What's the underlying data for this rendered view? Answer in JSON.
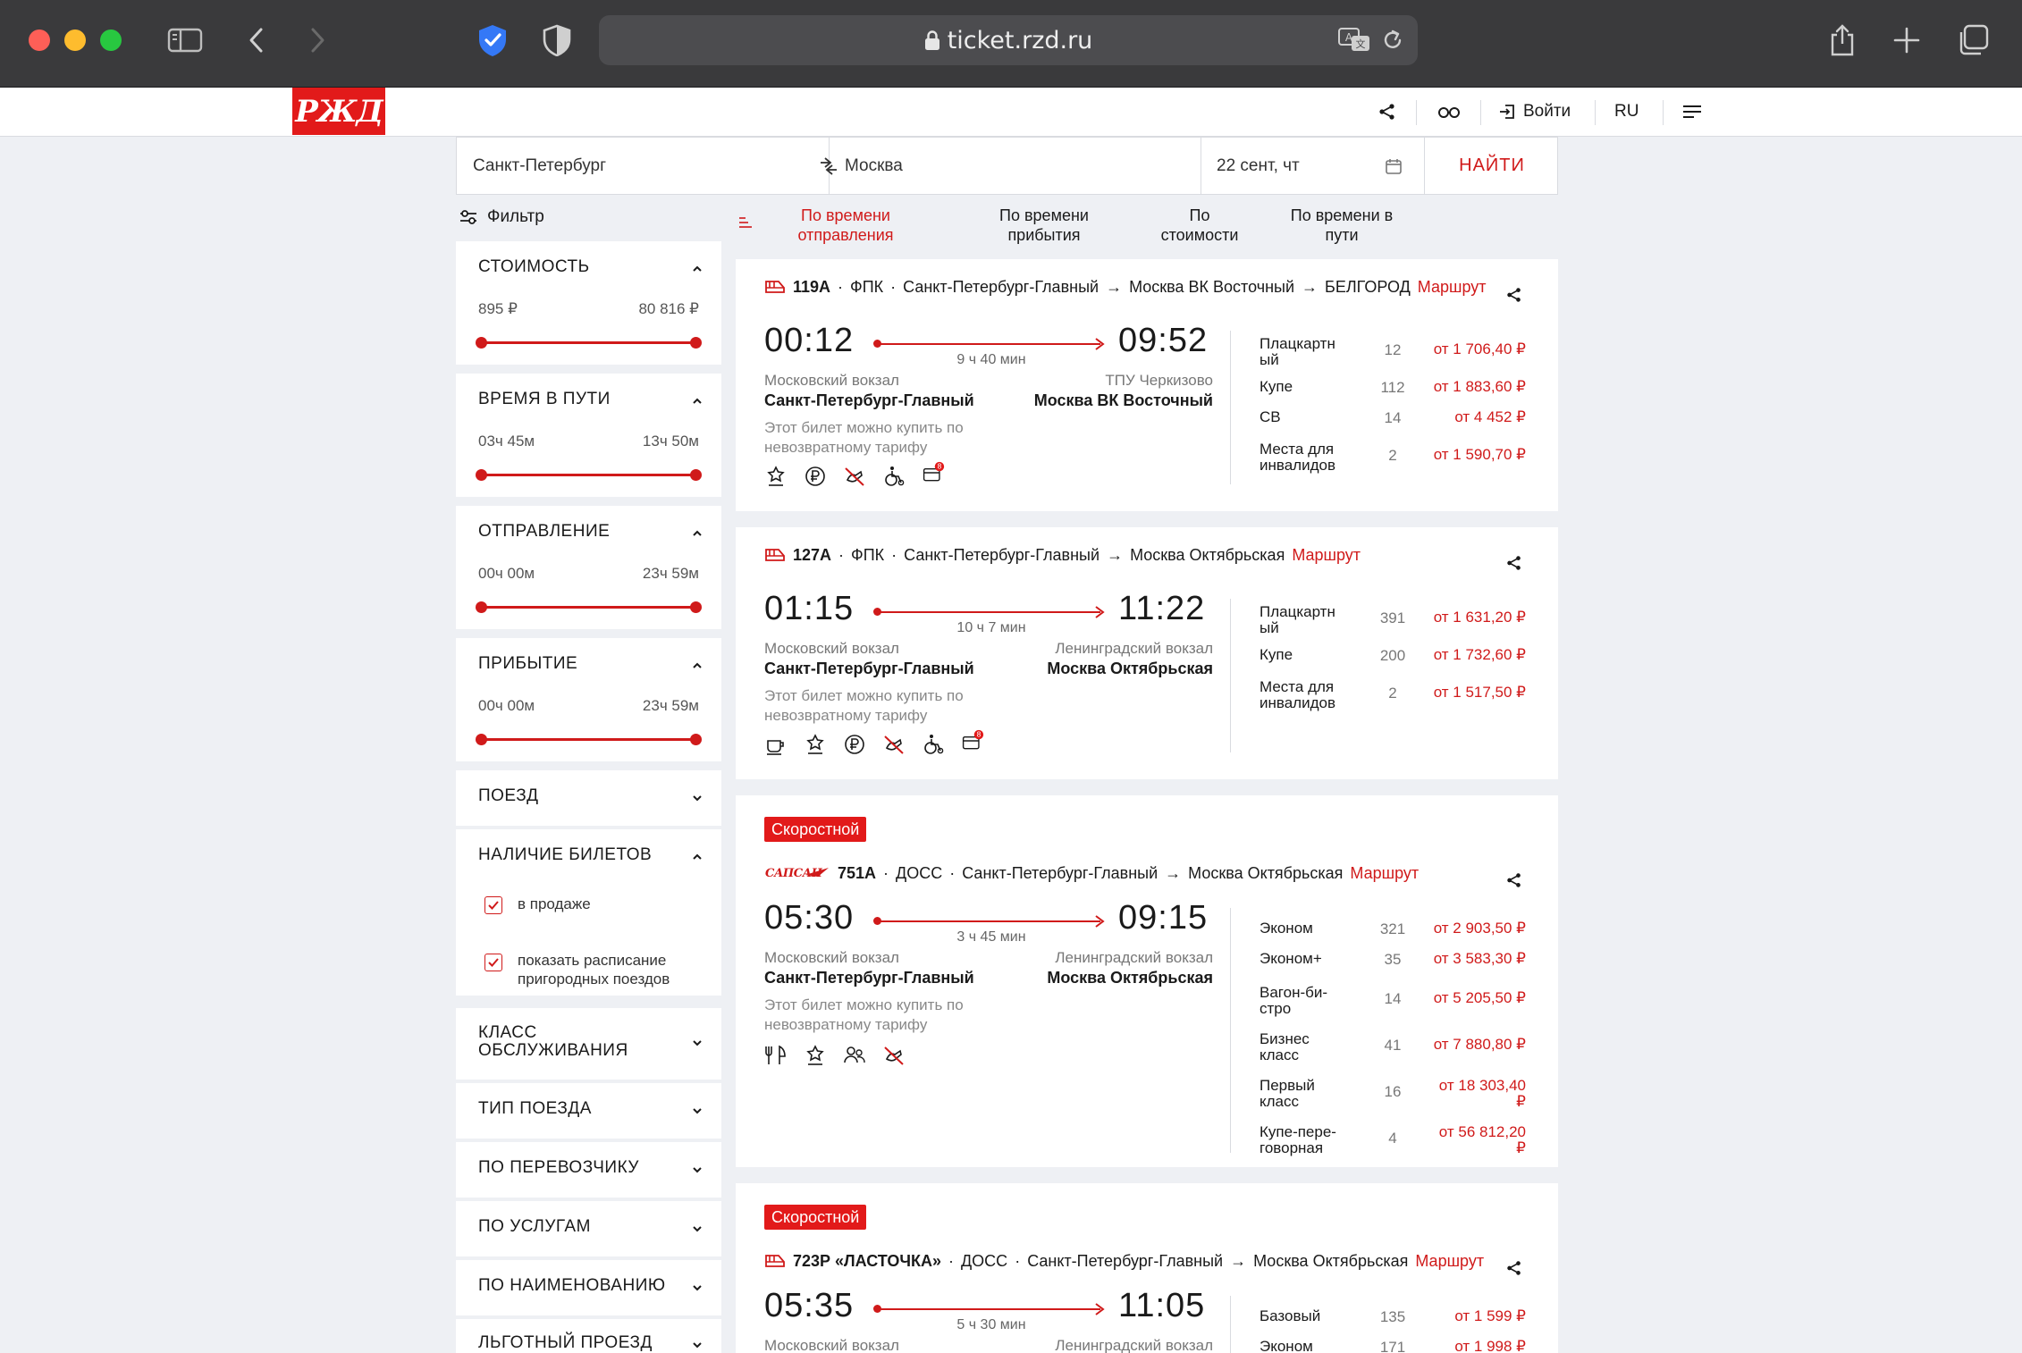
{
  "browser": {
    "url": "ticket.rzd.ru",
    "colors": {
      "chrome": "#3a3a3c",
      "close": "#fe5f57",
      "minimize": "#febc2e",
      "zoom": "#28c840"
    }
  },
  "site": {
    "logo_text": "РЖД",
    "header": {
      "login": "Войти",
      "lang": "RU"
    },
    "accent_color": "#e21a1a"
  },
  "search": {
    "from": "Санкт-Петербург",
    "to": "Москва",
    "date": "22 сент, чт",
    "find_button": "НАЙТИ"
  },
  "filter": {
    "title": "Фильтр",
    "cost": {
      "title": "СТОИМОСТЬ",
      "min": "895 ₽",
      "max": "80 816 ₽"
    },
    "duration": {
      "title": "ВРЕМЯ В ПУТИ",
      "min": "03ч 45м",
      "max": "13ч 50м"
    },
    "departure": {
      "title": "ОТПРАВЛЕНИЕ",
      "min": "00ч 00м",
      "max": "23ч 59м"
    },
    "arrival": {
      "title": "ПРИБЫТИЕ",
      "min": "00ч 00м",
      "max": "23ч 59м"
    },
    "train": {
      "title": "ПОЕЗД"
    },
    "tickets": {
      "title": "НАЛИЧИЕ БИЛЕТОВ",
      "on_sale": "в продаже",
      "suburban_l1": "показать расписание",
      "suburban_l2": "пригородных поездов"
    },
    "service_class": {
      "title_l1": "КЛАСС",
      "title_l2": "ОБСЛУЖИВАНИЯ"
    },
    "train_type": {
      "title": "ТИП ПОЕЗДА"
    },
    "carrier": {
      "title": "ПО ПЕРЕВОЗЧИКУ"
    },
    "services": {
      "title": "ПО УСЛУГАМ"
    },
    "name": {
      "title": "ПО НАИМЕНОВАНИЮ"
    },
    "benefit": {
      "title": "ЛЬГОТНЫЙ ПРОЕЗД"
    }
  },
  "sort": {
    "departure_l1": "По времени",
    "departure_l2": "отправления",
    "arrival_l1": "По времени",
    "arrival_l2": "прибытия",
    "cost_l1": "По",
    "cost_l2": "стоимости",
    "travel_l1": "По времени в",
    "travel_l2": "пути"
  },
  "trains": [
    {
      "number": "119А",
      "carrier": "ФПК",
      "route": "Санкт-Петербург-Главный",
      "to": "Москва ВК Восточный",
      "final": "БЕЛГОРОД",
      "route_link": "Маршрут",
      "dep_time": "00:12",
      "arr_time": "09:52",
      "duration": "9 ч 40 мин",
      "dep_station": "Московский вокзал",
      "dep_name": "Санкт-Петербург-Главный",
      "arr_station": "ТПУ Черкизово",
      "arr_name": "Москва ВК Восточный",
      "note_l1": "Этот билет можно купить по",
      "note_l2": "невозвратному тарифу",
      "classes": [
        {
          "l1": "Плацкартн",
          "l2": "ый",
          "seats": "12",
          "price": "от 1 706,40 ₽"
        },
        {
          "l1": "Купе",
          "l2": "",
          "seats": "112",
          "price": "от 1 883,60 ₽"
        },
        {
          "l1": "СВ",
          "l2": "",
          "seats": "14",
          "price": "от 4 452 ₽"
        },
        {
          "l1": "Места для",
          "l2": "инвалидов",
          "seats": "2",
          "price": "от 1 590,70 ₽"
        }
      ]
    },
    {
      "number": "127А",
      "carrier": "ФПК",
      "route": "Санкт-Петербург-Главный",
      "to": "Москва Октябрьская",
      "route_link": "Маршрут",
      "dep_time": "01:15",
      "arr_time": "11:22",
      "duration": "10 ч 7 мин",
      "dep_station": "Московский вокзал",
      "dep_name": "Санкт-Петербург-Главный",
      "arr_station": "Ленинградский вокзал",
      "arr_name": "Москва Октябрьская",
      "note_l1": "Этот билет можно купить по",
      "note_l2": "невозвратному тарифу",
      "classes": [
        {
          "l1": "Плацкартн",
          "l2": "ый",
          "seats": "391",
          "price": "от 1 631,20 ₽"
        },
        {
          "l1": "Купе",
          "l2": "",
          "seats": "200",
          "price": "от 1 732,60 ₽"
        },
        {
          "l1": "Места для",
          "l2": "инвалидов",
          "seats": "2",
          "price": "от 1 517,50 ₽"
        }
      ]
    },
    {
      "badge": "Скоростной",
      "brand": "САПСАН",
      "number": "751А",
      "carrier": "ДОСС",
      "route": "Санкт-Петербург-Главный",
      "to": "Москва Октябрьская",
      "route_link": "Маршрут",
      "dep_time": "05:30",
      "arr_time": "09:15",
      "duration": "3 ч 45 мин",
      "dep_station": "Московский вокзал",
      "dep_name": "Санкт-Петербург-Главный",
      "arr_station": "Ленинградский вокзал",
      "arr_name": "Москва Октябрьская",
      "note_l1": "Этот билет можно купить по",
      "note_l2": "невозвратному тарифу",
      "classes": [
        {
          "l1": "Эконом",
          "l2": "",
          "seats": "321",
          "price": "от 2 903,50 ₽"
        },
        {
          "l1": "Эконом+",
          "l2": "",
          "seats": "35",
          "price": "от 3 583,30 ₽"
        },
        {
          "l1": "Вагон-би-",
          "l2": "стро",
          "seats": "14",
          "price": "от 5 205,50 ₽"
        },
        {
          "l1": "Бизнес",
          "l2": "класс",
          "seats": "41",
          "price": "от 7 880,80 ₽"
        },
        {
          "l1": "Первый",
          "l2": "класс",
          "seats": "16",
          "price_l1": "от 18 303,40",
          "price_l2": "₽"
        },
        {
          "l1": "Купе-пере-",
          "l2": "говорная",
          "seats": "4",
          "price_l1": "от 56 812,20",
          "price_l2": "₽"
        }
      ]
    },
    {
      "badge": "Скоростной",
      "number": "723Р «ЛАСТОЧКА»",
      "carrier": "ДОСС",
      "route": "Санкт-Петербург-Главный",
      "to": "Москва Октябрьская",
      "route_link": "Маршрут",
      "dep_time": "05:35",
      "arr_time": "11:05",
      "duration": "5 ч 30 мин",
      "dep_station": "Московский вокзал",
      "arr_station": "Ленинградский вокзал",
      "classes": [
        {
          "l1": "Базовый",
          "l2": "",
          "seats": "135",
          "price": "от 1 599 ₽"
        },
        {
          "l1": "Эконом",
          "l2": "",
          "seats": "171",
          "price": "от 1 998 ₽"
        }
      ]
    }
  ]
}
